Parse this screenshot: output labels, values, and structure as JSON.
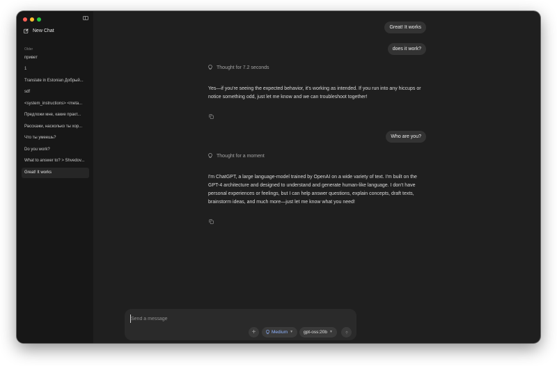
{
  "sidebar": {
    "new_chat_label": "New Chat",
    "section_label": "Older",
    "items": [
      {
        "label": "привет"
      },
      {
        "label": "1"
      },
      {
        "label": "Translate in Estonian Добрый..."
      },
      {
        "label": "sdf"
      },
      {
        "label": "<system_instructions> <meta..."
      },
      {
        "label": "Предложи мне, какие практ..."
      },
      {
        "label": "Расскажи, насколько ты хор..."
      },
      {
        "label": "Что ты умеешь?"
      },
      {
        "label": "Do you work?"
      },
      {
        "label": "What to answer to? > Shvedov..."
      },
      {
        "label": "Great! It works",
        "active": true
      }
    ]
  },
  "conversation": {
    "user_msg_1": "Great! It works",
    "user_msg_2": "does it work?",
    "thought_1": "Thought for 7.2 seconds",
    "reply_1": "Yes—if you're seeing the expected behavior, it's working as intended. If you run into any hiccups or notice something odd, just let me know and we can troubleshoot together!",
    "user_msg_3": "Who are you?",
    "thought_2": "Thought for a moment",
    "reply_2": "I'm ChatGPT, a large language-model trained by OpenAI on a wide variety of text. I'm built on the GPT-4 architecture and designed to understand and generate human-like language. I don't have personal experiences or feelings, but I can help answer questions, explain concepts, draft texts, brainstorm ideas, and much more—just let me know what you need!"
  },
  "composer": {
    "placeholder": "Send a message",
    "effort_label": "Medium",
    "model_label": "gpt-oss:20b"
  },
  "icons": {
    "new_chat": "edit-icon",
    "sidebar_toggle": "sidebar-toggle-icon",
    "thought": "lightbulb-icon",
    "copy": "copy-icon",
    "attach": "plus-icon",
    "send": "arrow-up-icon"
  }
}
